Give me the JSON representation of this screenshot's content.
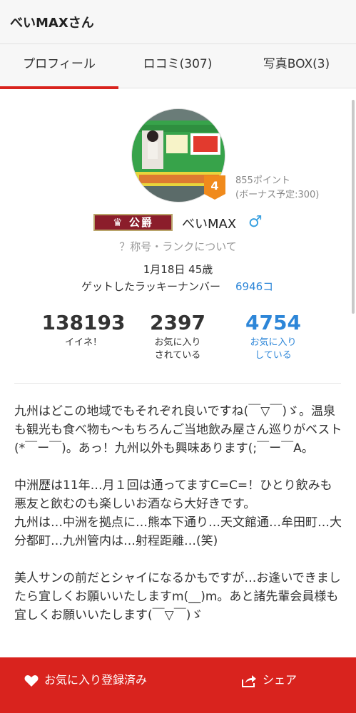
{
  "header": {
    "title": "べいMAXさん"
  },
  "tabs": [
    {
      "label": "プロフィール",
      "active": true
    },
    {
      "label": "ロコミ(307)",
      "active": false
    },
    {
      "label": "写真BOX(3)",
      "active": false
    }
  ],
  "profile": {
    "rank_level": "4",
    "points": "855ポイント",
    "bonus": "(ボーナス予定:300)",
    "title_badge": "公爵",
    "username": "べいMAX",
    "gender_icon": "male-icon",
    "rank_link": "？称号・ランクについて",
    "birth_age": "1月18日 45歳",
    "lucky_label": "ゲットしたラッキーナンバー",
    "lucky_value": "6946コ"
  },
  "stats": [
    {
      "value": "138193",
      "label": "イイネ！"
    },
    {
      "value": "2397",
      "label": "お気に入り\nされている"
    },
    {
      "value": "4754",
      "label": "お気に入り\nしている"
    }
  ],
  "bio": [
    "九州はどこの地域でもそれぞれ良いですね(￣▽￣)ゞ。温泉も観光も食べ物も〜もちろんご当地飲み屋さん巡りがベスト(*￣ー￣)。あっ！九州以外も興味あります(;￣ー￣A。",
    "中洲歴は11年…月１回は通ってますC=C=！ひとり飲みも悪友と飲むのも楽しいお酒なら大好きです。\n九州は…中洲を拠点に…熊本下通り…天文館通…牟田町…大分都町…九州管内は…射程距離…(笑)",
    "美人サンの前だとシャイになるかもですが…お逢いできましたら宜しくお願いいたしますm(__)m。あと諸先輩会員様も宜しくお願いいたします(￣▽￣)ゞ"
  ],
  "bottom": {
    "favorite_label": "お気に入り登録済み",
    "share_label": "シェア"
  },
  "colors": {
    "accent": "#d9231e",
    "link": "#2d86d8",
    "badge": "#f08a1c"
  }
}
